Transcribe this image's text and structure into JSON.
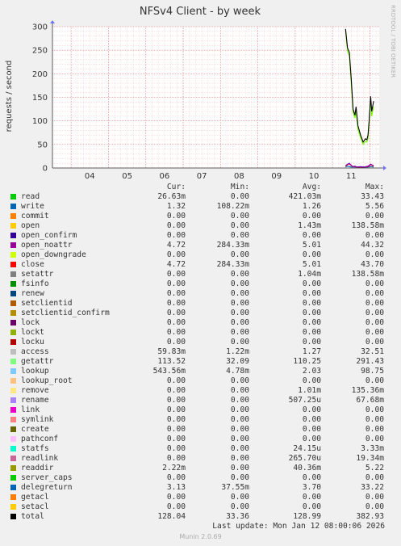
{
  "chart_data": {
    "type": "line",
    "title": "NFSv4 Client - by week",
    "ylabel": "requests / second",
    "watermark": "RRDTOOL / TOBI OETIKER",
    "ylim": [
      0,
      300
    ],
    "yticks": [
      0,
      50,
      100,
      150,
      200,
      250,
      300
    ],
    "xticks": [
      "04",
      "05",
      "06",
      "07",
      "08",
      "09",
      "10",
      "11"
    ],
    "grid": true,
    "series": [
      {
        "name": "total",
        "color": "#000000",
        "values": [
          [
            11.35,
            295
          ],
          [
            11.4,
            255
          ],
          [
            11.45,
            245
          ],
          [
            11.5,
            190
          ],
          [
            11.55,
            125
          ],
          [
            11.6,
            112
          ],
          [
            11.63,
            130
          ],
          [
            11.68,
            90
          ],
          [
            11.75,
            70
          ],
          [
            11.82,
            55
          ],
          [
            11.88,
            62
          ],
          [
            11.92,
            60
          ],
          [
            11.95,
            70
          ],
          [
            11.98,
            100
          ],
          [
            12.02,
            152
          ],
          [
            12.05,
            120
          ],
          [
            12.1,
            142
          ]
        ]
      },
      {
        "name": "getattr",
        "color": "#7cfc00",
        "values": [
          [
            11.35,
            290
          ],
          [
            11.4,
            248
          ],
          [
            11.45,
            238
          ],
          [
            11.5,
            180
          ],
          [
            11.55,
            118
          ],
          [
            11.6,
            106
          ],
          [
            11.63,
            120
          ],
          [
            11.68,
            82
          ],
          [
            11.75,
            64
          ],
          [
            11.82,
            50
          ],
          [
            11.88,
            56
          ],
          [
            11.92,
            55
          ],
          [
            11.95,
            62
          ],
          [
            11.98,
            92
          ],
          [
            12.02,
            140
          ],
          [
            12.05,
            110
          ],
          [
            12.1,
            130
          ]
        ]
      },
      {
        "name": "open_noattr",
        "color": "#7b00b4",
        "values": [
          [
            11.35,
            5
          ],
          [
            11.4,
            8
          ],
          [
            11.45,
            10
          ],
          [
            11.5,
            6
          ],
          [
            11.55,
            3
          ],
          [
            11.6,
            4
          ],
          [
            11.65,
            2
          ],
          [
            11.75,
            3
          ],
          [
            11.85,
            2
          ],
          [
            11.95,
            4
          ],
          [
            12.02,
            8
          ],
          [
            12.1,
            5
          ]
        ]
      },
      {
        "name": "close",
        "color": "#ff0000",
        "values": [
          [
            11.35,
            4
          ],
          [
            11.4,
            7
          ],
          [
            11.45,
            9
          ],
          [
            11.5,
            5
          ],
          [
            11.55,
            3
          ],
          [
            11.6,
            3
          ],
          [
            11.65,
            2
          ],
          [
            11.75,
            2
          ],
          [
            11.85,
            2
          ],
          [
            11.95,
            3
          ],
          [
            12.02,
            7
          ],
          [
            12.1,
            4
          ]
        ]
      },
      {
        "name": "lookup",
        "color": "#0066b3",
        "values": [
          [
            11.35,
            2
          ],
          [
            11.4,
            4
          ],
          [
            11.45,
            3
          ],
          [
            11.5,
            2
          ],
          [
            11.6,
            2
          ],
          [
            11.7,
            1
          ],
          [
            11.85,
            1
          ],
          [
            11.95,
            2
          ],
          [
            12.02,
            3
          ],
          [
            12.1,
            2
          ]
        ]
      }
    ],
    "legend_header": {
      "cur": "Cur:",
      "min": "Min:",
      "avg": "Avg:",
      "max": "Max:"
    },
    "legend": [
      {
        "name": "read",
        "color": "#00cc00",
        "cur": "26.63m",
        "min": "0.00",
        "avg": "421.03m",
        "max": "33.43"
      },
      {
        "name": "write",
        "color": "#0066b3",
        "cur": "1.32",
        "min": "108.22m",
        "avg": "1.26",
        "max": "5.56"
      },
      {
        "name": "commit",
        "color": "#ff8000",
        "cur": "0.00",
        "min": "0.00",
        "avg": "0.00",
        "max": "0.00"
      },
      {
        "name": "open",
        "color": "#ffcc00",
        "cur": "0.00",
        "min": "0.00",
        "avg": "1.43m",
        "max": "138.58m"
      },
      {
        "name": "open_confirm",
        "color": "#330099",
        "cur": "0.00",
        "min": "0.00",
        "avg": "0.00",
        "max": "0.00"
      },
      {
        "name": "open_noattr",
        "color": "#990099",
        "cur": "4.72",
        "min": "284.33m",
        "avg": "5.01",
        "max": "44.32"
      },
      {
        "name": "open_downgrade",
        "color": "#ccff00",
        "cur": "0.00",
        "min": "0.00",
        "avg": "0.00",
        "max": "0.00"
      },
      {
        "name": "close",
        "color": "#ff0000",
        "cur": "4.72",
        "min": "284.33m",
        "avg": "5.01",
        "max": "43.70"
      },
      {
        "name": "setattr",
        "color": "#808080",
        "cur": "0.00",
        "min": "0.00",
        "avg": "1.04m",
        "max": "138.58m"
      },
      {
        "name": "fsinfo",
        "color": "#008f00",
        "cur": "0.00",
        "min": "0.00",
        "avg": "0.00",
        "max": "0.00"
      },
      {
        "name": "renew",
        "color": "#00487d",
        "cur": "0.00",
        "min": "0.00",
        "avg": "0.00",
        "max": "0.00"
      },
      {
        "name": "setclientid",
        "color": "#b35a00",
        "cur": "0.00",
        "min": "0.00",
        "avg": "0.00",
        "max": "0.00"
      },
      {
        "name": "setclientid_confirm",
        "color": "#b38f00",
        "cur": "0.00",
        "min": "0.00",
        "avg": "0.00",
        "max": "0.00"
      },
      {
        "name": "lock",
        "color": "#6b006b",
        "cur": "0.00",
        "min": "0.00",
        "avg": "0.00",
        "max": "0.00"
      },
      {
        "name": "lockt",
        "color": "#8fb300",
        "cur": "0.00",
        "min": "0.00",
        "avg": "0.00",
        "max": "0.00"
      },
      {
        "name": "locku",
        "color": "#b30000",
        "cur": "0.00",
        "min": "0.00",
        "avg": "0.00",
        "max": "0.00"
      },
      {
        "name": "access",
        "color": "#bebebe",
        "cur": "59.83m",
        "min": "1.22m",
        "avg": "1.27",
        "max": "32.51"
      },
      {
        "name": "getattr",
        "color": "#80ff80",
        "cur": "113.52",
        "min": "32.09",
        "avg": "110.25",
        "max": "291.43"
      },
      {
        "name": "lookup",
        "color": "#80c9ff",
        "cur": "543.56m",
        "min": "4.78m",
        "avg": "2.03",
        "max": "98.75"
      },
      {
        "name": "lookup_root",
        "color": "#ffc080",
        "cur": "0.00",
        "min": "0.00",
        "avg": "0.00",
        "max": "0.00"
      },
      {
        "name": "remove",
        "color": "#ffe680",
        "cur": "0.00",
        "min": "0.00",
        "avg": "1.01m",
        "max": "135.36m"
      },
      {
        "name": "rename",
        "color": "#aa80ff",
        "cur": "0.00",
        "min": "0.00",
        "avg": "507.25u",
        "max": "67.68m"
      },
      {
        "name": "link",
        "color": "#ee00cc",
        "cur": "0.00",
        "min": "0.00",
        "avg": "0.00",
        "max": "0.00"
      },
      {
        "name": "symlink",
        "color": "#ff8080",
        "cur": "0.00",
        "min": "0.00",
        "avg": "0.00",
        "max": "0.00"
      },
      {
        "name": "create",
        "color": "#666600",
        "cur": "0.00",
        "min": "0.00",
        "avg": "0.00",
        "max": "0.00"
      },
      {
        "name": "pathconf",
        "color": "#ffbfff",
        "cur": "0.00",
        "min": "0.00",
        "avg": "0.00",
        "max": "0.00"
      },
      {
        "name": "statfs",
        "color": "#00ffcc",
        "cur": "0.00",
        "min": "0.00",
        "avg": "24.15u",
        "max": "3.33m"
      },
      {
        "name": "readlink",
        "color": "#cc6699",
        "cur": "0.00",
        "min": "0.00",
        "avg": "265.70u",
        "max": "19.34m"
      },
      {
        "name": "readdir",
        "color": "#999900",
        "cur": "2.22m",
        "min": "0.00",
        "avg": "40.36m",
        "max": "5.22"
      },
      {
        "name": "server_caps",
        "color": "#00cc00",
        "cur": "0.00",
        "min": "0.00",
        "avg": "0.00",
        "max": "0.00"
      },
      {
        "name": "delegreturn",
        "color": "#0066b3",
        "cur": "3.13",
        "min": "37.55m",
        "avg": "3.70",
        "max": "33.22"
      },
      {
        "name": "getacl",
        "color": "#ff8000",
        "cur": "0.00",
        "min": "0.00",
        "avg": "0.00",
        "max": "0.00"
      },
      {
        "name": "setacl",
        "color": "#ffcc00",
        "cur": "0.00",
        "min": "0.00",
        "avg": "0.00",
        "max": "0.00"
      },
      {
        "name": "total",
        "color": "#000000",
        "cur": "128.04",
        "min": "33.36",
        "avg": "128.99",
        "max": "382.93"
      }
    ],
    "last_update": "Last update: Mon Jan 12 08:00:06 2026",
    "footer": "Munin 2.0.69"
  }
}
